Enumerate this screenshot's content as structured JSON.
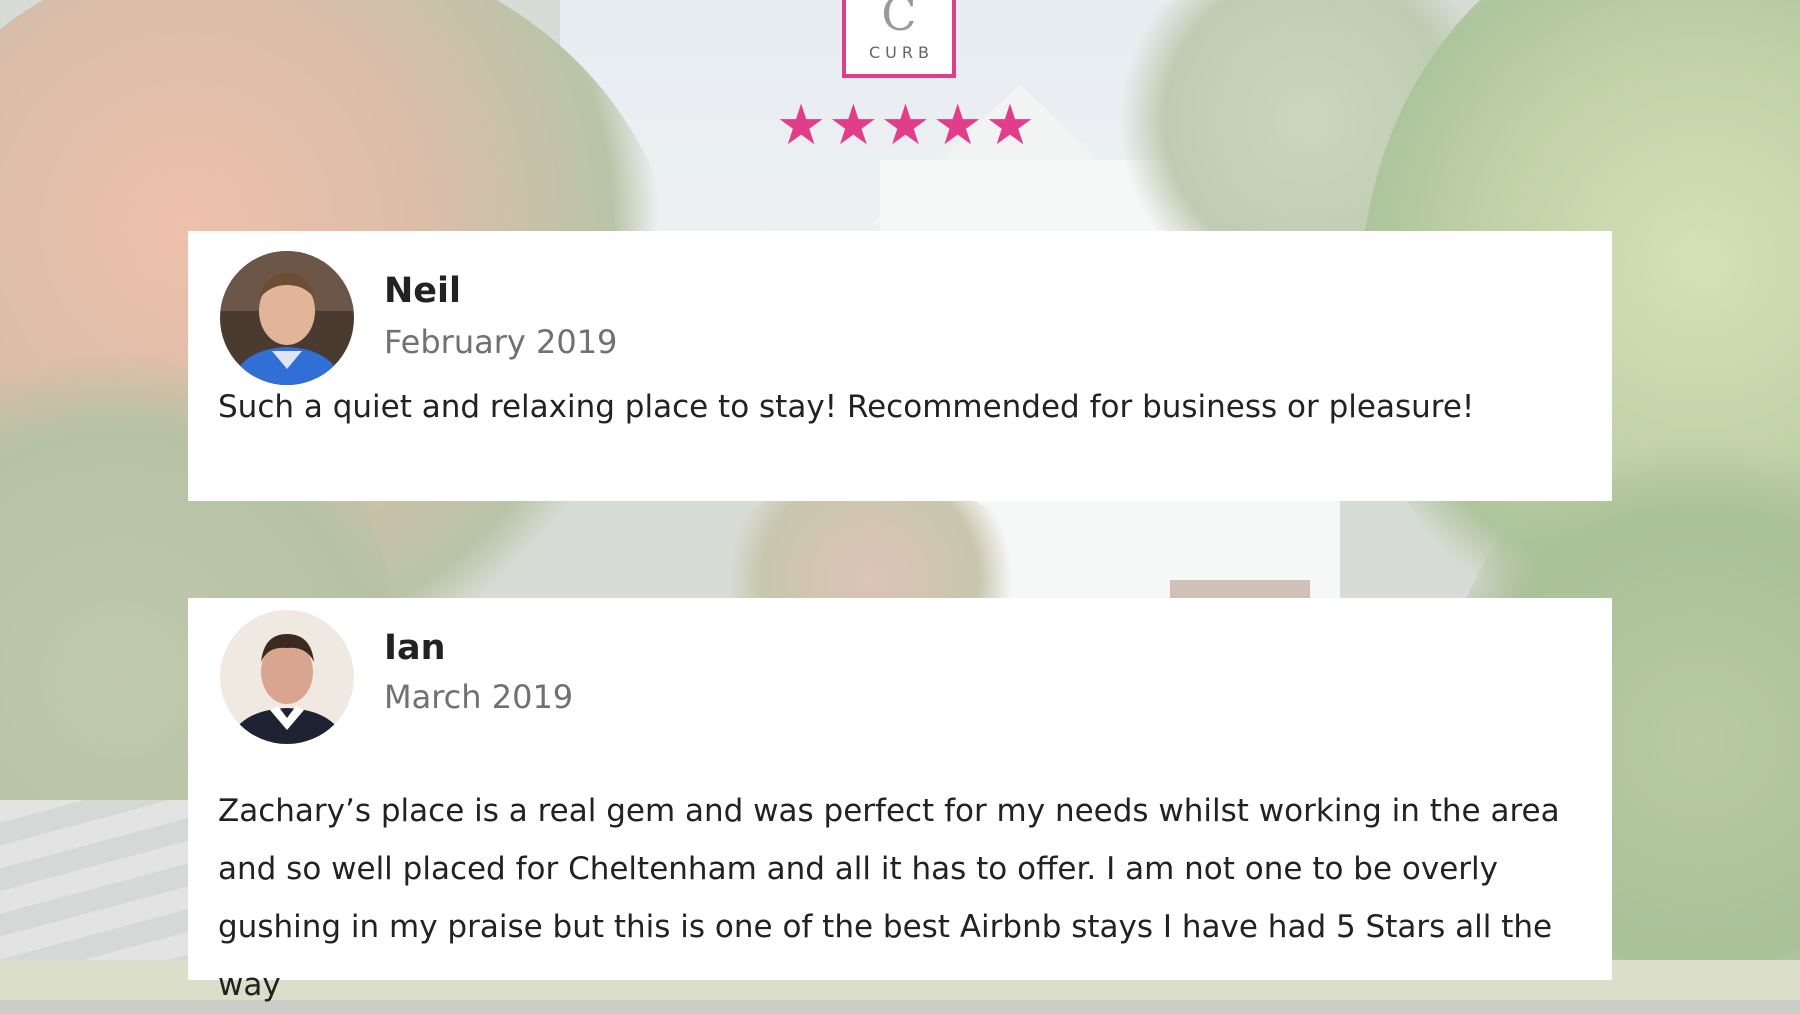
{
  "logo": {
    "mark": "C",
    "text": "CURB"
  },
  "rating": {
    "stars": 5,
    "max": 5,
    "color": "#e23d8a"
  },
  "reviews": [
    {
      "name": "Neil",
      "date": "February 2019",
      "text": "Such a quiet and relaxing place to stay! Recommended for business or pleasure!"
    },
    {
      "name": "Ian",
      "date": "March 2019",
      "text": "Zachary’s place is a real gem and was perfect for my needs whilst working in the area and so well placed for Cheltenham and all it has to offer. I am not one to be overly gushing in my praise but this is one of the best Airbnb stays I have had 5 Stars all the way"
    }
  ],
  "colors": {
    "brand": "#df3f87",
    "text": "#222222",
    "muted": "#717171"
  }
}
